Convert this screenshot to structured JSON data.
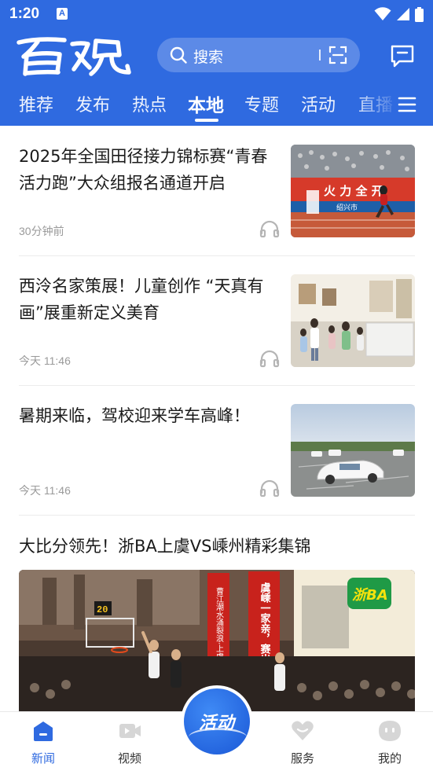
{
  "status_bar": {
    "time": "1:20",
    "notification_letter": "A"
  },
  "header": {
    "logo_text": "百观",
    "search_placeholder": "搜索",
    "tabs": [
      {
        "label": "推荐",
        "active": false
      },
      {
        "label": "发布",
        "active": false
      },
      {
        "label": "热点",
        "active": false
      },
      {
        "label": "本地",
        "active": true
      },
      {
        "label": "专题",
        "active": false
      },
      {
        "label": "活动",
        "active": false
      },
      {
        "label": "直播",
        "active": false
      }
    ]
  },
  "feed": {
    "items": [
      {
        "title": "2025年全国田径接力锦标赛“青春活力跑”大众组报名通道开启",
        "time": "30分钟前",
        "thumbnail": "athletics-track-photo",
        "thumb_banner_text": "火 力 全 开",
        "thumb_sub_text": "绍兴市"
      },
      {
        "title": "西泠名家策展！儿童创作 “天真有画”展重新定义美育",
        "time": "今天 11:46",
        "thumbnail": "children-exhibition-photo"
      },
      {
        "title": "暑期来临，驾校迎来学车高峰！",
        "time": "今天 11:46",
        "thumbnail": "driving-school-photo"
      }
    ],
    "featured": {
      "title": "大比分领先！浙BA上虞VS嵊州精彩集锦",
      "image": "basketball-game-photo",
      "logo_text": "浙BA",
      "scoreboard_text": "20",
      "banner_left": "曹江潮水涌裂浪·上虞攻坚",
      "banner_right": "虞嵊一家亲，赛出高水平！"
    }
  },
  "bottom_nav": {
    "items": [
      {
        "label": "新闻",
        "icon": "news-icon",
        "active": true
      },
      {
        "label": "视频",
        "icon": "video-icon",
        "active": false
      },
      {
        "label": "服务",
        "icon": "heart-icon",
        "active": false
      },
      {
        "label": "我的",
        "icon": "profile-icon",
        "active": false
      }
    ],
    "center_label": "活动"
  },
  "colors": {
    "brand_blue": "#2f6ae0",
    "active_nav": "#2f6ae0",
    "meta_gray": "#9a9a9a"
  }
}
